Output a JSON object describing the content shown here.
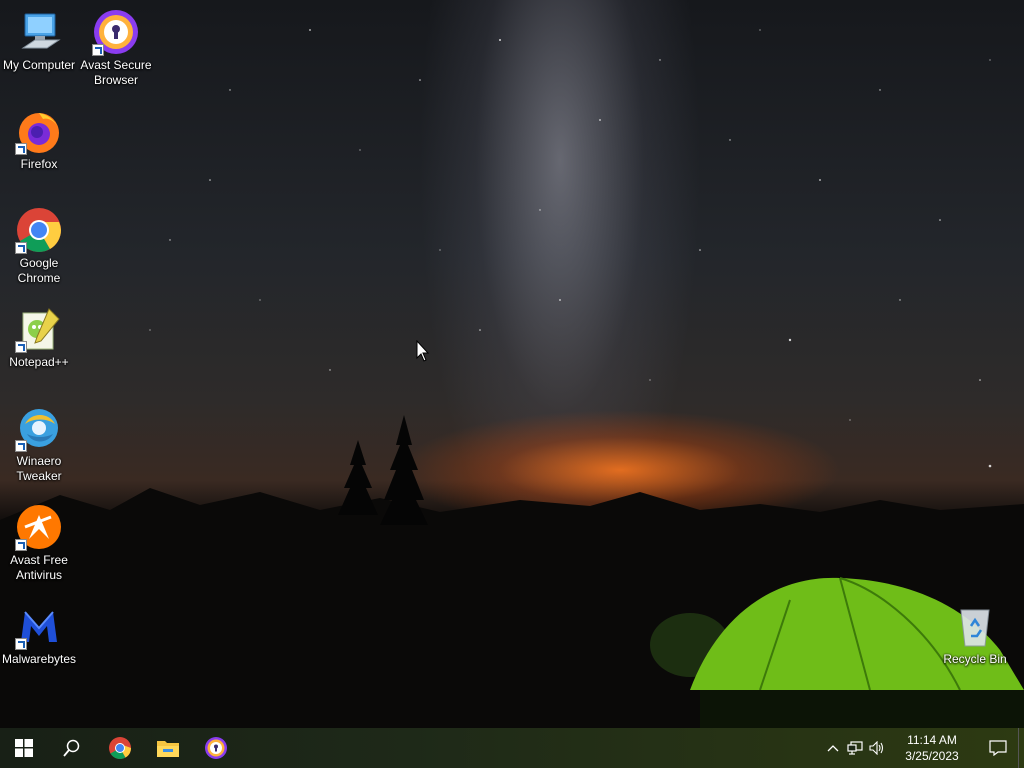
{
  "desktop": {
    "icons": [
      {
        "id": "my-computer",
        "label": "My Computer",
        "icon": "computer-icon"
      },
      {
        "id": "avast-secure-browser",
        "label": "Avast Secure Browser",
        "icon": "avast-browser-icon"
      },
      {
        "id": "firefox",
        "label": "Firefox",
        "icon": "firefox-icon"
      },
      {
        "id": "google-chrome",
        "label": "Google Chrome",
        "icon": "chrome-icon"
      },
      {
        "id": "notepad-plus-plus",
        "label": "Notepad++",
        "icon": "notepadpp-icon"
      },
      {
        "id": "winaero-tweaker",
        "label": "Winaero Tweaker",
        "icon": "winaero-icon"
      },
      {
        "id": "avast-free-antivirus",
        "label": "Avast Free Antivirus",
        "icon": "avast-antivirus-icon"
      },
      {
        "id": "malwarebytes",
        "label": "Malwarebytes",
        "icon": "malwarebytes-icon"
      },
      {
        "id": "recycle-bin",
        "label": "Recycle Bin",
        "icon": "recycle-bin-icon"
      }
    ]
  },
  "taskbar": {
    "pinned": [
      {
        "name": "start",
        "icon": "windows-logo-icon"
      },
      {
        "name": "search",
        "icon": "search-icon"
      },
      {
        "name": "chrome",
        "icon": "chrome-icon"
      },
      {
        "name": "file-explorer",
        "icon": "folder-icon"
      },
      {
        "name": "avast-secure-browser",
        "icon": "avast-browser-icon"
      }
    ],
    "tray": {
      "icons": [
        "chevron-up-icon",
        "network-icon",
        "volume-icon"
      ],
      "time": "11:14 AM",
      "date": "3/25/2023",
      "notification_icon": "notification-icon"
    }
  },
  "colors": {
    "taskbar_left": "#182016",
    "taskbar_right": "#2d3a12",
    "tent_green": "#7ac21e"
  }
}
